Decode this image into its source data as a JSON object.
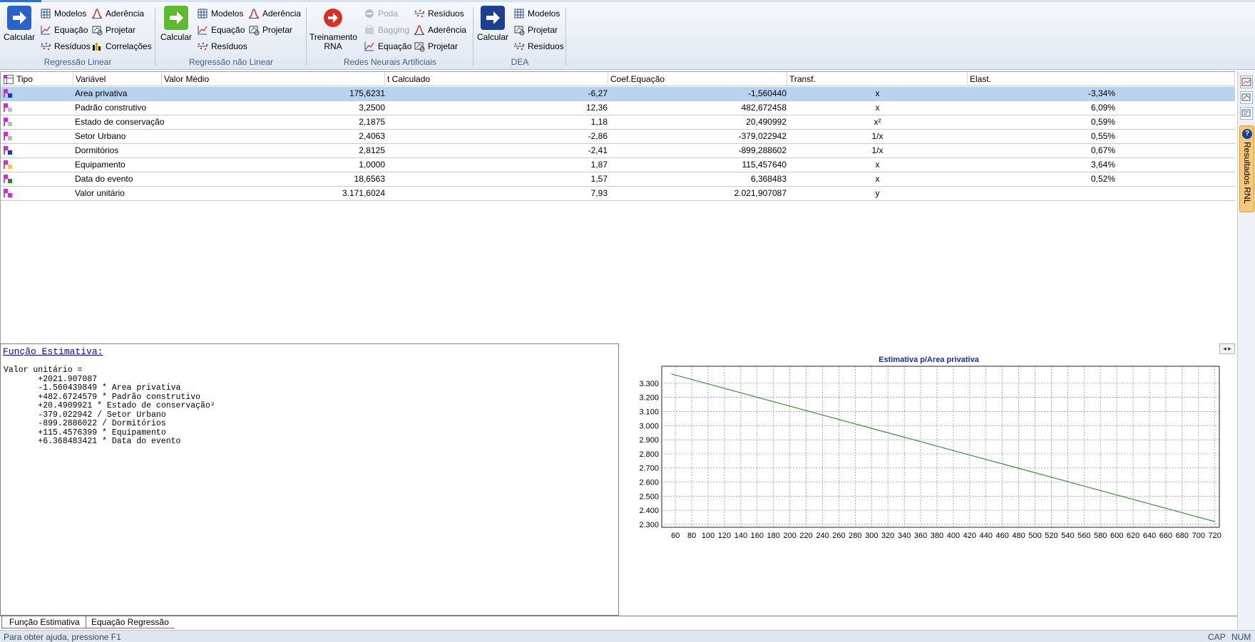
{
  "ribbon": {
    "groups": [
      {
        "label": "Regressão Linear",
        "calc_label": "Calcular",
        "buttons": [
          "Modelos",
          "Aderência",
          "Equação",
          "Projetar",
          "Resíduos",
          "Correlações"
        ]
      },
      {
        "label": "Regressão não Linear",
        "calc_label": "Calcular",
        "buttons": [
          "Modelos",
          "Aderência",
          "Equação",
          "Projetar",
          "Resíduos"
        ]
      },
      {
        "label": "Redes Neurais Artificiais",
        "calc_label_1": "Treinamento",
        "calc_label_2": "RNA",
        "buttons": [
          "Poda",
          "Resíduos",
          "Bagging",
          "Aderência",
          "Equação",
          "Projetar"
        ]
      },
      {
        "label": "DEA",
        "calc_label": "Calcular",
        "buttons": [
          "Modelos",
          "Projetar",
          "Resíduos"
        ]
      }
    ]
  },
  "table": {
    "columns": [
      "Tipo",
      "Variável",
      "Valor Médio",
      "t Calculado",
      "Coef.Equação",
      "Transf.",
      "Elast."
    ],
    "rows": [
      {
        "variable": "Area privativa",
        "mean": "175,6231",
        "t": "-6,27",
        "coef": "-1,560440",
        "transf": "x",
        "elast": "-3,34%",
        "selected": true,
        "icon_color": "#1a33d6"
      },
      {
        "variable": "Padrão construtivo",
        "mean": "3,2500",
        "t": "12,36",
        "coef": "482,672458",
        "transf": "x",
        "elast": "6,09%",
        "selected": false,
        "icon_color": "#bdbdbd"
      },
      {
        "variable": "Estado de conservação",
        "mean": "2,1875",
        "t": "1,18",
        "coef": "20,490992",
        "transf": "x²",
        "elast": "0,59%",
        "selected": false,
        "icon_color": "#bdbdbd"
      },
      {
        "variable": "Setor Urbano",
        "mean": "2,4063",
        "t": "-2,86",
        "coef": "-379,022942",
        "transf": "1/x",
        "elast": "0,55%",
        "selected": false,
        "icon_color": "#bdbdbd"
      },
      {
        "variable": "Dormitórios",
        "mean": "2,8125",
        "t": "-2,41",
        "coef": "-899,288602",
        "transf": "1/x",
        "elast": "0,67%",
        "selected": false,
        "icon_color": "#1a33d6"
      },
      {
        "variable": "Equipamento",
        "mean": "1,0000",
        "t": "1,87",
        "coef": "115,457640",
        "transf": "x",
        "elast": "3,64%",
        "selected": false,
        "icon_color": "#f2d22a"
      },
      {
        "variable": "Data do evento",
        "mean": "18,6563",
        "t": "1,57",
        "coef": "6,368483",
        "transf": "x",
        "elast": "0,52%",
        "selected": false,
        "icon_color": "#1f8f2a"
      },
      {
        "variable": "Valor unitário",
        "mean": "3.171,6024",
        "t": "7,93",
        "coef": "2.021,907087",
        "transf": "y",
        "elast": "",
        "selected": false,
        "icon_color": "#e020e0"
      }
    ]
  },
  "equation": {
    "title": "Função Estimativa:",
    "lines": [
      "Valor unitário =",
      "       +2021.907087",
      "       -1.560439849 * Area privativa",
      "       +482.6724579 * Padrão construtivo",
      "       +20.4909921 * Estado de conservação²",
      "       -379.022942 / Setor Urbano",
      "       -899.2886022 / Dormitórios",
      "       +115.4576399 * Equipamento",
      "       +6.368483421 * Data do evento"
    ]
  },
  "chart_data": {
    "type": "line",
    "title": "Estimativa p/Area privativa",
    "xlabel": "",
    "ylabel": "",
    "x_ticks": [
      60,
      80,
      100,
      120,
      140,
      160,
      180,
      200,
      220,
      240,
      260,
      280,
      300,
      320,
      340,
      360,
      380,
      400,
      420,
      440,
      460,
      480,
      500,
      520,
      540,
      560,
      580,
      600,
      620,
      640,
      660,
      680,
      700,
      720
    ],
    "y_ticks": [
      "2.300",
      "2.400",
      "2.500",
      "2.600",
      "2.700",
      "2.800",
      "2.900",
      "3.000",
      "3.100",
      "3.200",
      "3.300"
    ],
    "xlim": [
      45,
      722
    ],
    "ylim": [
      2300,
      3390
    ],
    "series": [
      {
        "name": "",
        "color": "#2a8a2a",
        "x": [
          55,
          720
        ],
        "y": [
          3366,
          2320
        ]
      }
    ],
    "grid": true,
    "legend": "none"
  },
  "tabs": [
    "Função Estimativa",
    "Equação Regressão"
  ],
  "side_tab": {
    "label": "Resultados RNL"
  },
  "status": {
    "message": "Para obter ajuda, pressione F1",
    "cap": "CAP",
    "num": "NUM"
  }
}
